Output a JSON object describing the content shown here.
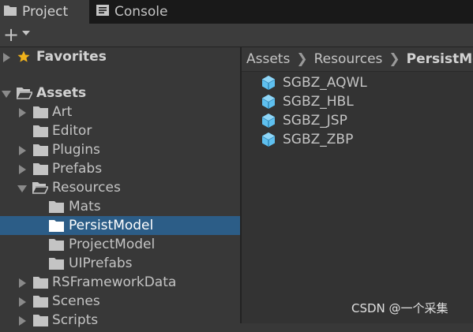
{
  "tabs": [
    {
      "label": "Project",
      "icon": "folder-icon",
      "active": true
    },
    {
      "label": "Console",
      "icon": "console-icon",
      "active": false
    }
  ],
  "toolbar": {
    "add_icon": "plus-icon",
    "dropdown_icon": "caret-down-icon"
  },
  "tree": [
    {
      "label": "Favorites",
      "icon": "star-icon",
      "bold": true
    },
    {
      "label": "Assets",
      "icon": "folder-open-icon",
      "bold": true
    },
    {
      "label": "Art",
      "icon": "folder-icon"
    },
    {
      "label": "Editor",
      "icon": "folder-icon"
    },
    {
      "label": "Plugins",
      "icon": "folder-icon"
    },
    {
      "label": "Prefabs",
      "icon": "folder-icon"
    },
    {
      "label": "Resources",
      "icon": "folder-open-icon"
    },
    {
      "label": "Mats",
      "icon": "folder-icon"
    },
    {
      "label": "PersistModel",
      "icon": "folder-icon",
      "selected": true
    },
    {
      "label": "ProjectModel",
      "icon": "folder-icon"
    },
    {
      "label": "UIPrefabs",
      "icon": "folder-icon"
    },
    {
      "label": "RSFrameworkData",
      "icon": "folder-icon"
    },
    {
      "label": "Scenes",
      "icon": "folder-icon"
    },
    {
      "label": "Scripts",
      "icon": "folder-icon"
    }
  ],
  "breadcrumb": [
    "Assets",
    "Resources",
    "PersistModel"
  ],
  "assets": [
    {
      "label": "SGBZ_AQWL",
      "icon": "prefab-cube-icon"
    },
    {
      "label": "SGBZ_HBL",
      "icon": "prefab-cube-icon"
    },
    {
      "label": "SGBZ_JSP",
      "icon": "prefab-cube-icon"
    },
    {
      "label": "SGBZ_ZBP",
      "icon": "prefab-cube-icon"
    }
  ],
  "colors": {
    "selection": "#2c5d87",
    "prefab": "#5fc0ef",
    "star": "#f0b21b"
  },
  "watermark": "CSDN @一个采集"
}
